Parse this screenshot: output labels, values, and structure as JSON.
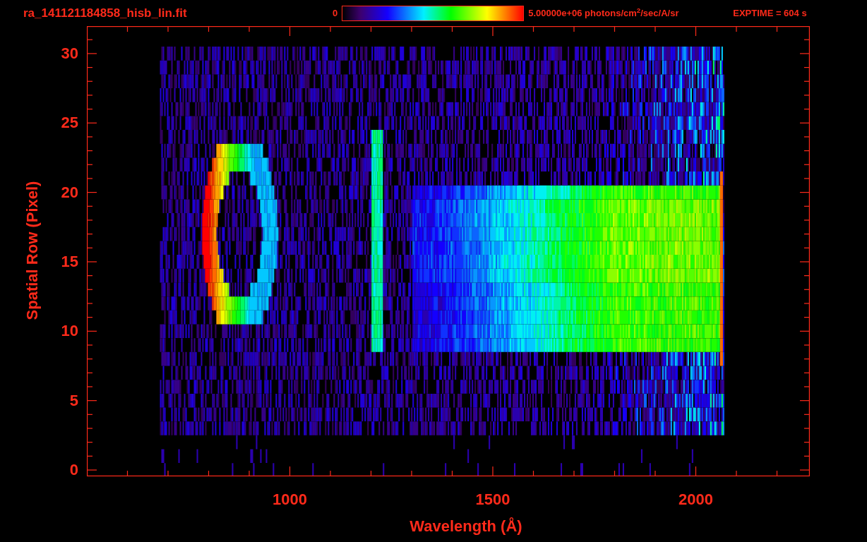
{
  "title": "ra_141121184858_hisb_lin.fit",
  "colorbar": {
    "min_label": "0",
    "max_label": "5.00000e+06 photons/cm$^{2}$/sec/A/sr"
  },
  "exposure": "EXPTIME = 604 s",
  "y_axis": {
    "label": "Spatial Row (Pixel)",
    "ticks": [
      "30",
      "25",
      "20",
      "15",
      "10",
      "5",
      "0"
    ]
  },
  "x_axis": {
    "label": "Wavelength (Å)",
    "ticks": [
      "1000",
      "1500",
      "2000"
    ]
  }
}
